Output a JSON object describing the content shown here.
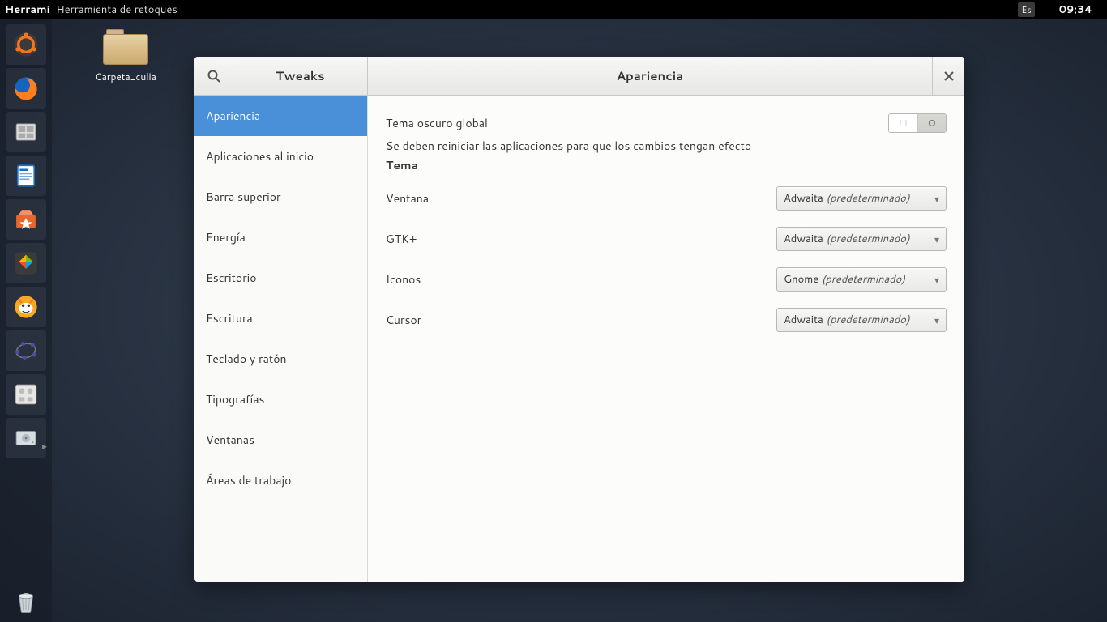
{
  "menubar": {
    "app_short": "Herrami",
    "app_title": "Herramienta de retoques",
    "keyboard": "Es",
    "clock": "09:34"
  },
  "desktop": {
    "folder_label": "Carpeta_culia"
  },
  "launcher": {
    "items": [
      {
        "name": "dash-icon"
      },
      {
        "name": "firefox-icon"
      },
      {
        "name": "files-icon"
      },
      {
        "name": "writer-icon"
      },
      {
        "name": "software-center-icon"
      },
      {
        "name": "winebox-icon"
      },
      {
        "name": "scratch-icon"
      },
      {
        "name": "geogebra-icon"
      },
      {
        "name": "system-settings-icon"
      },
      {
        "name": "disk-icon"
      }
    ],
    "trash": "trash-icon"
  },
  "tweaks": {
    "sidebar_title": "Tweaks",
    "header_title": "Apariencia",
    "sidebar": [
      "Apariencia",
      "Aplicaciones al inicio",
      "Barra superior",
      "Energía",
      "Escritorio",
      "Escritura",
      "Teclado y ratón",
      "Tipografías",
      "Ventanas",
      "Áreas de trabajo"
    ],
    "sidebar_active": 0,
    "content": {
      "dark_theme_label": "Tema oscuro global",
      "dark_theme_hint": "Se deben reiniciar las aplicaciones para que los cambios tengan efecto",
      "dark_theme_on": false,
      "section_theme": "Tema",
      "rows": [
        {
          "label": "Ventana",
          "value": "Adwaita",
          "default": "(predeterminado)"
        },
        {
          "label": "GTK+",
          "value": "Adwaita",
          "default": "(predeterminado)"
        },
        {
          "label": "Iconos",
          "value": "Gnome",
          "default": "(predeterminado)"
        },
        {
          "label": "Cursor",
          "value": "Adwaita",
          "default": "(predeterminado)"
        }
      ],
      "switch_on_glyph": "I I",
      "switch_off_glyph": "O"
    }
  }
}
